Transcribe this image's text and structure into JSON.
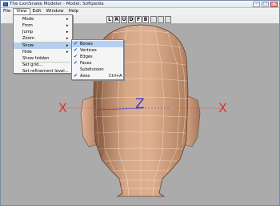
{
  "window": {
    "title": "The LionSnake Modeler - Model: Softpedia",
    "minimize": "–",
    "maximize": "□",
    "close": "✕"
  },
  "menubar": [
    "File",
    "View",
    "Edit",
    "Window",
    "Help"
  ],
  "toolbar": {
    "buttons": [
      "L",
      "R",
      "U",
      "D",
      "F",
      "B"
    ]
  },
  "view_menu": [
    {
      "label": "Mode",
      "submenu": true
    },
    {
      "label": "From",
      "submenu": true
    },
    {
      "label": "Jump",
      "submenu": true
    },
    {
      "label": "Zoom",
      "submenu": true
    },
    {
      "label": "Show",
      "submenu": true
    },
    {
      "label": "Hide",
      "submenu": true
    },
    {
      "label": "Show hidden",
      "submenu": false
    },
    {
      "label": "Set grid...",
      "submenu": false
    },
    {
      "label": "Set refinement level...",
      "submenu": false
    }
  ],
  "show_menu": [
    {
      "label": "Bones",
      "checked": true
    },
    {
      "label": "Vertices",
      "checked": true
    },
    {
      "label": "Edges",
      "checked": true
    },
    {
      "label": "Faces",
      "checked": true
    },
    {
      "label": "Subdivision",
      "checked": false
    },
    {
      "label": "Axes",
      "checked": true,
      "shortcut": "Ctrl+A"
    }
  ],
  "viewport": {
    "left_axis_label": "X",
    "right_axis_label": "X",
    "center_axis_label": "Z"
  },
  "colors": {
    "axis_x": "#e23030",
    "axis_z": "#3a3ad8",
    "skin": "#d6a382",
    "skin_dark": "#9a6a4c",
    "background": "#ababab",
    "highlight": "#b5d0ee"
  }
}
